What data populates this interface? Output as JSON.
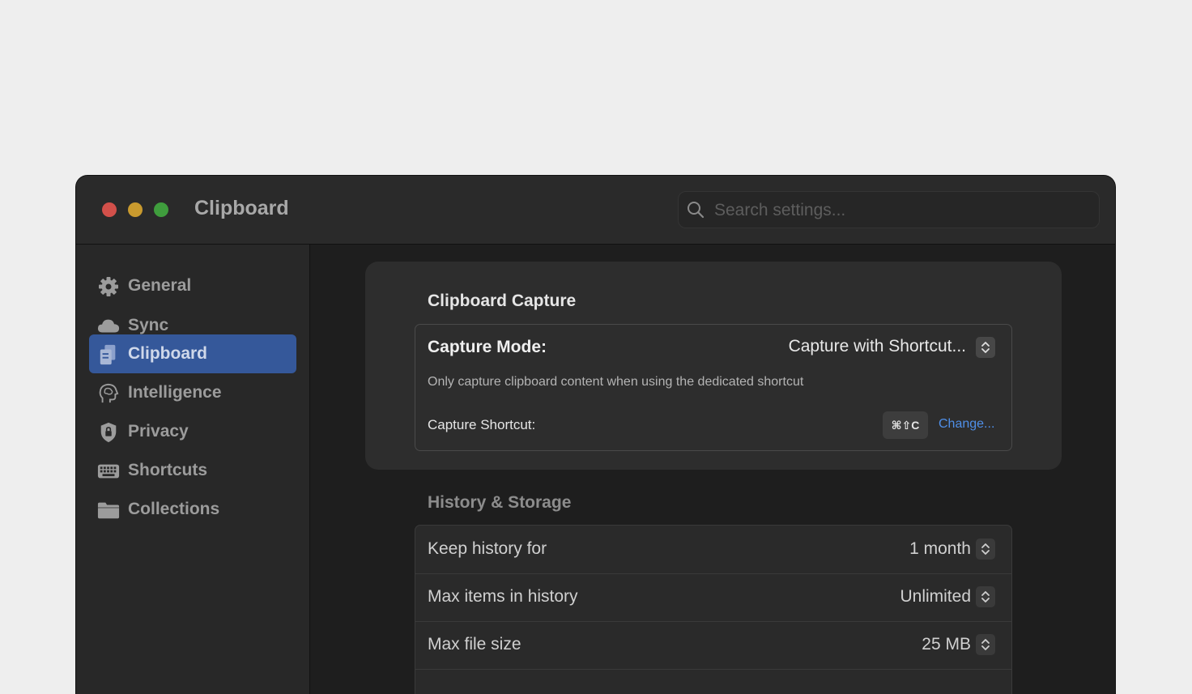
{
  "window": {
    "title": "Clipboard"
  },
  "search": {
    "placeholder": "Search settings..."
  },
  "sidebar": {
    "items": [
      {
        "label": "General",
        "icon": "gear-icon",
        "active": false
      },
      {
        "label": "Sync",
        "icon": "cloud-icon",
        "active": false
      },
      {
        "label": "Clipboard",
        "icon": "clipboard-icon",
        "active": true
      },
      {
        "label": "Intelligence",
        "icon": "brain-head-icon",
        "active": false
      },
      {
        "label": "Privacy",
        "icon": "shield-lock-icon",
        "active": false
      },
      {
        "label": "Shortcuts",
        "icon": "keyboard-icon",
        "active": false
      },
      {
        "label": "Collections",
        "icon": "folder-icon",
        "active": false
      }
    ]
  },
  "capture": {
    "section_title": "Clipboard Capture",
    "mode_label": "Capture Mode:",
    "mode_value": "Capture with Shortcut...",
    "mode_description": "Only capture clipboard content when using the dedicated shortcut",
    "shortcut_label": "Capture Shortcut:",
    "shortcut_key": "⌘⇧C",
    "change_label": "Change..."
  },
  "history": {
    "section_title": "History & Storage",
    "rows": [
      {
        "label": "Keep history for",
        "value": "1 month"
      },
      {
        "label": "Max items in history",
        "value": "Unlimited"
      },
      {
        "label": "Max file size",
        "value": "25 MB"
      }
    ]
  },
  "colors": {
    "accent_selection": "#35589a",
    "link": "#4f8fe8",
    "traffic_red": "#d2504a",
    "traffic_yellow": "#c99a2e",
    "traffic_green": "#3f9d3d"
  }
}
